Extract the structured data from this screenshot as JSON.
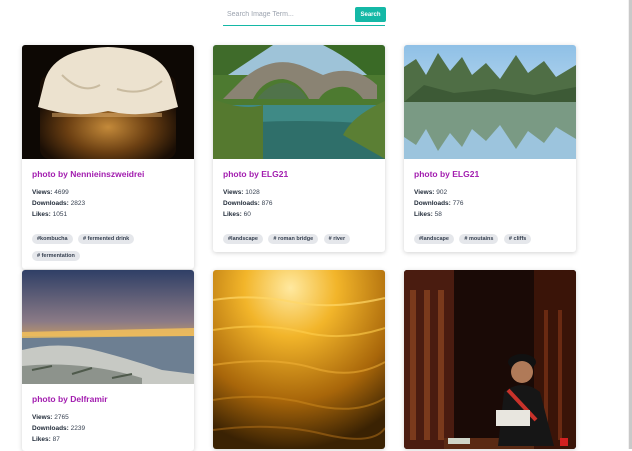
{
  "search": {
    "placeholder": "Search Image Term...",
    "button_label": "Search"
  },
  "cards": [
    {
      "title": "photo by Nennieinszweidrei",
      "views_label": "Views:",
      "views": "4699",
      "downloads_label": "Downloads:",
      "downloads": "2823",
      "likes_label": "Likes:",
      "likes": "1051",
      "tags": [
        "#kombucha",
        "# fermented drink",
        "# fermentation"
      ],
      "image": "kombucha-jar-photo"
    },
    {
      "title": "photo by ELG21",
      "views_label": "Views:",
      "views": "1028",
      "downloads_label": "Downloads:",
      "downloads": "876",
      "likes_label": "Likes:",
      "likes": "60",
      "tags": [
        "#landscape",
        "# roman bridge",
        "# river"
      ],
      "image": "roman-bridge-photo"
    },
    {
      "title": "photo by ELG21",
      "views_label": "Views:",
      "views": "902",
      "downloads_label": "Downloads:",
      "downloads": "776",
      "likes_label": "Likes:",
      "likes": "58",
      "tags": [
        "#landscape",
        "# moutains",
        "# cliffs"
      ],
      "image": "cliffs-lake-photo"
    },
    {
      "title": "photo by Delframir",
      "views_label": "Views:",
      "views": "2765",
      "downloads_label": "Downloads:",
      "downloads": "2239",
      "likes_label": "Likes:",
      "likes": "87",
      "tags": [],
      "image": "sunset-shore-photo"
    },
    {
      "image": "golden-water-photo"
    },
    {
      "image": "reading-woman-photo"
    }
  ],
  "colors": {
    "accent": "#14b8a6",
    "title": "#a21caf",
    "tag_bg": "#e5e7eb"
  }
}
